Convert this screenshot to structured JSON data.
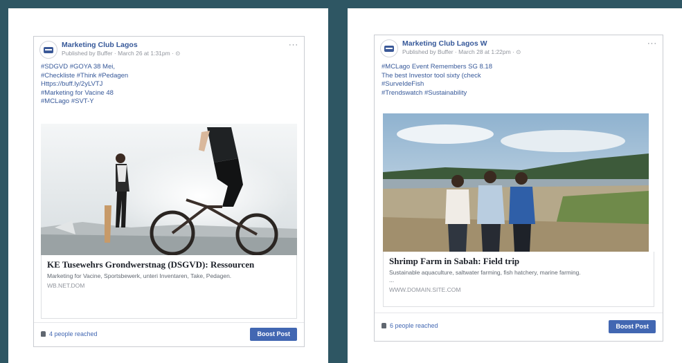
{
  "left_post": {
    "page_name": "Marketing Club Lagos",
    "meta": "Published by Buffer · March 26 at 1:31pm · ⊙",
    "more": "···",
    "text_lines": [
      "#SDGVD #GOYA 38 Mei,",
      "#Checkliste #Think #Pedagen",
      "Https://buff.ly/2yLVTJ",
      "#Marketing for Vacine 48",
      "#MCLago #SVT-Y"
    ],
    "link_title": "KE Tusewehrs Grondwerstnag (DSGVD): Ressourcen",
    "link_desc": "Marketing for Vacine, Sportsbewerk, unteri Inventaren, Take, Pedagen.",
    "link_domain": "WB.NET.DOM",
    "reach": "4 people reached",
    "boost": "Boost Post"
  },
  "right_post": {
    "page_name": "Marketing Club Lagos W",
    "meta": "Published by Buffer · March 28 at 1:22pm · ⊙",
    "more": "···",
    "text_lines": [
      "#MCLago Event Remembers SG 8.18",
      "The best Investor tool sixty (check",
      "#SurveIdeFish",
      "#Trendswatch #Sustainability"
    ],
    "link_title": "Shrimp Farm in Sabah: Field trip",
    "link_desc": "Sustainable aquaculture, saltwater farming, fish hatchery, marine farming.",
    "link_desc2": "...",
    "link_domain": "WWW.DOMAIN.SITE.COM",
    "reach": "6 people reached",
    "boost": "Boost Post"
  },
  "colors": {
    "background": "#2e5663",
    "facebook_blue": "#4267b2",
    "link_blue": "#365899"
  }
}
